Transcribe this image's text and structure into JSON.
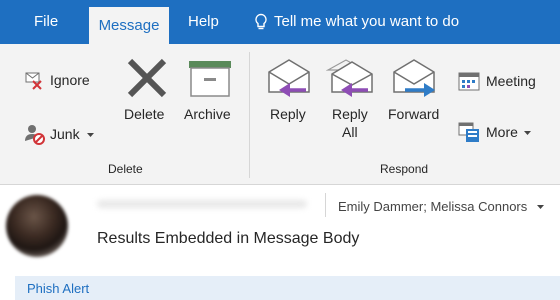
{
  "tabs": [
    "File",
    "Message",
    "Help"
  ],
  "tell_me": "Tell me what you want to do",
  "ribbon": {
    "delete_group": {
      "label": "Delete",
      "ignore": "Ignore",
      "junk": "Junk",
      "delete": "Delete",
      "archive": "Archive"
    },
    "respond_group": {
      "label": "Respond",
      "reply": "Reply",
      "reply_all_line1": "Reply",
      "reply_all_line2": "All",
      "forward": "Forward",
      "meeting": "Meeting",
      "more": "More"
    }
  },
  "message": {
    "recipients": "Emily Dammer; Melissa Connors",
    "subject": "Results Embedded in Message Body"
  },
  "infobar": {
    "phish_alert": "Phish Alert"
  },
  "colors": {
    "tab_bar": "#1e6fc1",
    "ribbon_bg": "#f3f3f3",
    "reply_arrow": "#8e4db5",
    "forward_arrow": "#2f7cc7",
    "archive_green": "#5a8a5a",
    "infobar_bg": "#e5eef8"
  },
  "icons": [
    "lightbulb-icon",
    "ignore-icon",
    "junk-icon",
    "delete-x-icon",
    "archive-box-icon",
    "reply-envelope-icon",
    "reply-all-envelope-icon",
    "forward-envelope-icon",
    "meeting-calendar-icon",
    "more-icon",
    "chevron-down-icon"
  ]
}
